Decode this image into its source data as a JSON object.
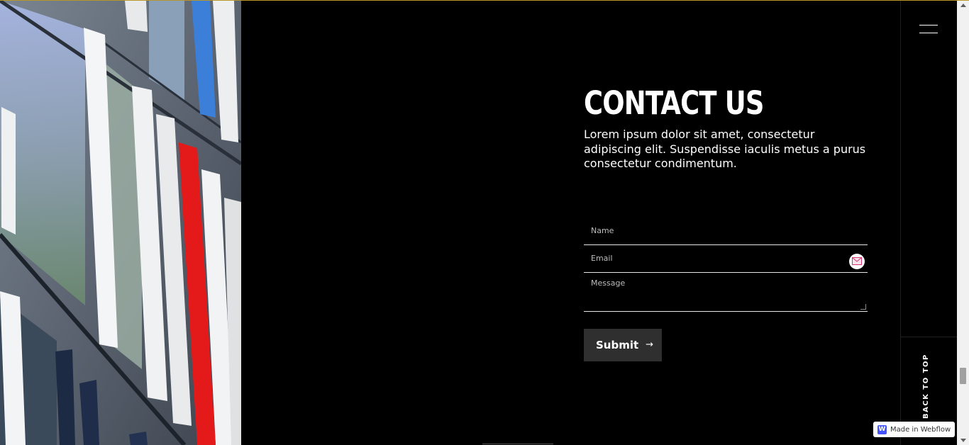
{
  "contact": {
    "title": "CONTACT US",
    "lead": "Lorem ipsum dolor sit amet, consectetur adipiscing elit. Suspendisse iaculis metus a purus consectetur condimentum.",
    "fields": {
      "name_placeholder": "Name",
      "email_placeholder": "Email",
      "message_placeholder": "Message"
    },
    "submit_label": "Submit",
    "submit_icon": "arrow-right-icon"
  },
  "rail": {
    "menu_icon": "hamburger-menu-icon",
    "back_to_top": "BACK TO TOP"
  },
  "badge": {
    "label": "Made in Webflow",
    "logo_letter": "W",
    "logo_color": "#4353ff"
  },
  "colors": {
    "background": "#000000",
    "button": "#2f2f2f",
    "accent_red": "#e41a1a",
    "accent_blue": "#3b7fd9",
    "top_border": "#b8962a"
  }
}
